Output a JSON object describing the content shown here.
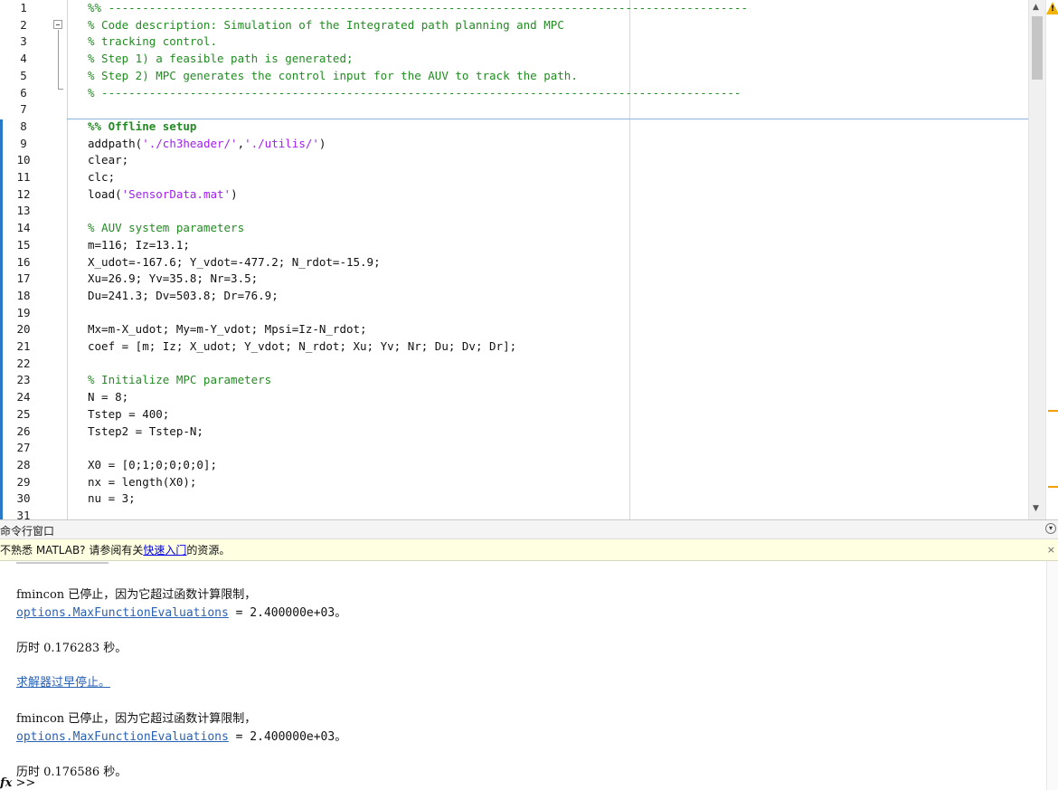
{
  "editor": {
    "lines": [
      {
        "n": "1",
        "kind": "cmt",
        "text": "%% ----------------------------------------------------------------------------------------------"
      },
      {
        "n": "2",
        "kind": "cmt",
        "text": "% Code description: Simulation of the Integrated path planning and MPC"
      },
      {
        "n": "3",
        "kind": "cmt",
        "text": "% tracking control."
      },
      {
        "n": "4",
        "kind": "cmt",
        "text": "% Step 1) a feasible path is generated;"
      },
      {
        "n": "5",
        "kind": "cmt",
        "text": "% Step 2) MPC generates the control input for the AUV to track the path."
      },
      {
        "n": "6",
        "kind": "cmt",
        "text": "% ----------------------------------------------------------------------------------------------"
      },
      {
        "n": "7",
        "kind": "plain",
        "text": ""
      },
      {
        "n": "8",
        "kind": "sec",
        "text": "%% Offline setup"
      },
      {
        "n": "9",
        "kind": "addpath",
        "text": "addpath('./ch3header/','./utilis/')"
      },
      {
        "n": "10",
        "kind": "plain",
        "text": "clear;"
      },
      {
        "n": "11",
        "kind": "plain",
        "text": "clc;"
      },
      {
        "n": "12",
        "kind": "load",
        "text": "load('SensorData.mat')"
      },
      {
        "n": "13",
        "kind": "plain",
        "text": ""
      },
      {
        "n": "14",
        "kind": "cmt",
        "text": "% AUV system parameters"
      },
      {
        "n": "15",
        "kind": "plain",
        "text": "m=116; Iz=13.1;"
      },
      {
        "n": "16",
        "kind": "plain",
        "text": "X_udot=-167.6; Y_vdot=-477.2; N_rdot=-15.9;"
      },
      {
        "n": "17",
        "kind": "plain",
        "text": "Xu=26.9; Yv=35.8; Nr=3.5;"
      },
      {
        "n": "18",
        "kind": "plain",
        "text": "Du=241.3; Dv=503.8; Dr=76.9;"
      },
      {
        "n": "19",
        "kind": "plain",
        "text": ""
      },
      {
        "n": "20",
        "kind": "plain",
        "text": "Mx=m-X_udot; My=m-Y_vdot; Mpsi=Iz-N_rdot;"
      },
      {
        "n": "21",
        "kind": "plain",
        "text": "coef = [m; Iz; X_udot; Y_vdot; N_rdot; Xu; Yv; Nr; Du; Dv; Dr];"
      },
      {
        "n": "22",
        "kind": "plain",
        "text": ""
      },
      {
        "n": "23",
        "kind": "cmt",
        "text": "% Initialize MPC parameters"
      },
      {
        "n": "24",
        "kind": "plain",
        "text": "N = 8;"
      },
      {
        "n": "25",
        "kind": "plain",
        "text": "Tstep = 400;"
      },
      {
        "n": "26",
        "kind": "plain",
        "text": "Tstep2 = Tstep-N;"
      },
      {
        "n": "27",
        "kind": "plain",
        "text": ""
      },
      {
        "n": "28",
        "kind": "plain",
        "text": "X0 = [0;1;0;0;0;0];"
      },
      {
        "n": "29",
        "kind": "plain",
        "text": "nx = length(X0);"
      },
      {
        "n": "30",
        "kind": "plain",
        "text": "nu = 3;"
      },
      {
        "n": "31",
        "kind": "plain",
        "text": ""
      }
    ],
    "addpath_parts": [
      "addpath(",
      "'./ch3header/'",
      ",",
      "'./utilis/'",
      ")"
    ],
    "load_parts": [
      "load(",
      "'SensorData.mat'",
      ")"
    ],
    "scroll_up": "▲",
    "scroll_down": "▼",
    "warning_glyph": "!"
  },
  "command_window": {
    "title": "命令行窗口",
    "menu_glyph": "▾",
    "notice": {
      "prefix": "不熟悉 MATLAB? 请参阅有关",
      "link": "快速入门",
      "suffix": "的资源。",
      "close": "×"
    },
    "output": [
      {
        "text": "fmincon 已停止，因为它超过函数计算限制，"
      },
      {
        "link": "options.MaxFunctionEvaluations",
        "rest": " = 2.400000e+03。"
      },
      {
        "text": "历时 0.176283 秒。"
      },
      {
        "link": "求解器过早停止。",
        "rest": ""
      },
      {
        "text": "fmincon 已停止，因为它超过函数计算限制，"
      },
      {
        "link": "options.MaxFunctionEvaluations",
        "rest": " = 2.400000e+03。"
      },
      {
        "text": "历时 0.176586 秒。"
      }
    ],
    "prompt_fx": "fx",
    "prompt": ">>"
  }
}
